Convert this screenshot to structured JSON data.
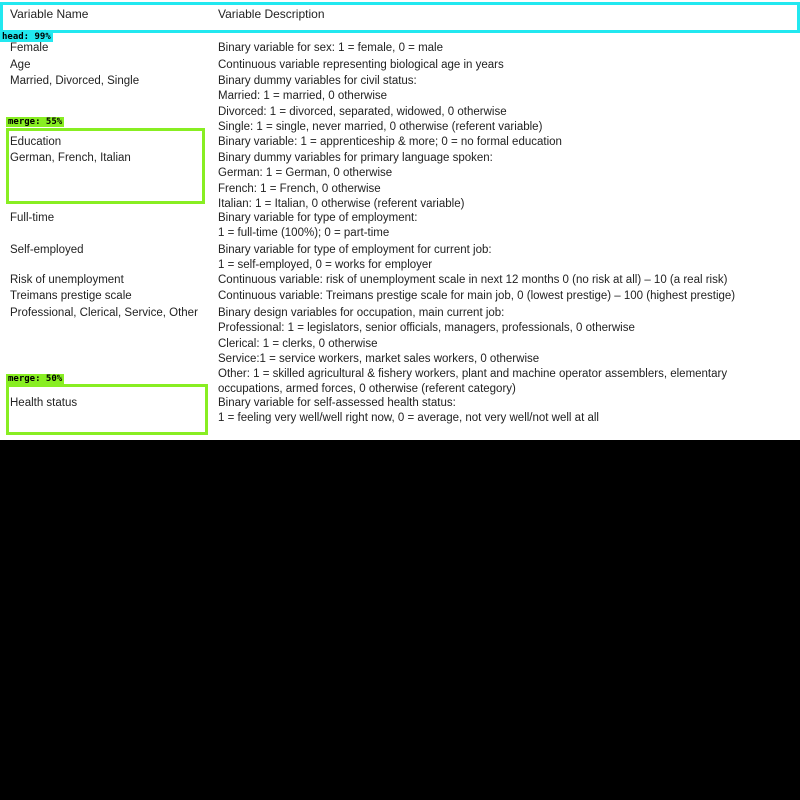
{
  "table": {
    "header": {
      "name": "Variable Name",
      "description": "Variable Description"
    },
    "rows": [
      {
        "name": "Female",
        "desc": [
          "Binary variable for sex: 1 = female, 0 = male"
        ]
      },
      {
        "name": "Age",
        "desc": [
          "Continuous variable representing biological age in years"
        ]
      },
      {
        "name": "Married, Divorced, Single",
        "desc": [
          "Binary dummy variables for civil status:",
          "Married: 1 = married, 0 otherwise",
          "Divorced: 1 = divorced, separated, widowed, 0 otherwise",
          "Single: 1 = single, never married, 0 otherwise (referent variable)"
        ]
      },
      {
        "name": "Education",
        "desc": [
          "Binary variable: 1 = apprenticeship & more; 0 = no formal education"
        ]
      },
      {
        "name": "German, French, Italian",
        "desc": [
          "Binary dummy variables for primary language spoken:",
          "German: 1 = German, 0 otherwise",
          "French: 1 = French, 0 otherwise",
          "Italian: 1 = Italian, 0 otherwise (referent variable)"
        ]
      },
      {
        "name": "Full-time",
        "desc": [
          "Binary variable for type of employment:",
          "1 = full-time (100%); 0 = part-time"
        ]
      },
      {
        "name": "Self-employed",
        "desc": [
          "Binary variable for type of employment for current job:",
          "1 = self-employed, 0 = works for employer"
        ]
      },
      {
        "name": "Risk of unemployment",
        "desc": [
          "Continuous variable: risk of unemployment scale in next 12 months 0 (no risk at all) – 10 (a real risk)"
        ]
      },
      {
        "name": "Treimans prestige scale",
        "desc": [
          "Continuous variable: Treimans prestige scale for main job, 0 (lowest prestige) – 100 (highest prestige)"
        ]
      },
      {
        "name": "Professional, Clerical, Service, Other",
        "desc": [
          "Binary design variables for occupation, main current job:",
          "Professional: 1 = legislators, senior officials, managers, professionals, 0 otherwise",
          "Clerical: 1 = clerks, 0 otherwise",
          "Service:1 = service workers, market sales workers, 0 otherwise",
          "Other: 1 = skilled agricultural & fishery workers, plant and machine operator assemblers, elementary",
          "occupations, armed forces, 0 otherwise (referent category)"
        ]
      },
      {
        "name": "Health status",
        "desc": [
          "Binary variable for self-assessed health status:",
          "1 = feeling very well/well right now, 0 = average, not very well/not well at all"
        ]
      }
    ]
  },
  "detections": [
    {
      "label": "head: 99%",
      "color": "#22e8f0"
    },
    {
      "label": "merge: 55%",
      "color": "#88ee22"
    },
    {
      "label": "merge: 50%",
      "color": "#88ee22"
    }
  ]
}
